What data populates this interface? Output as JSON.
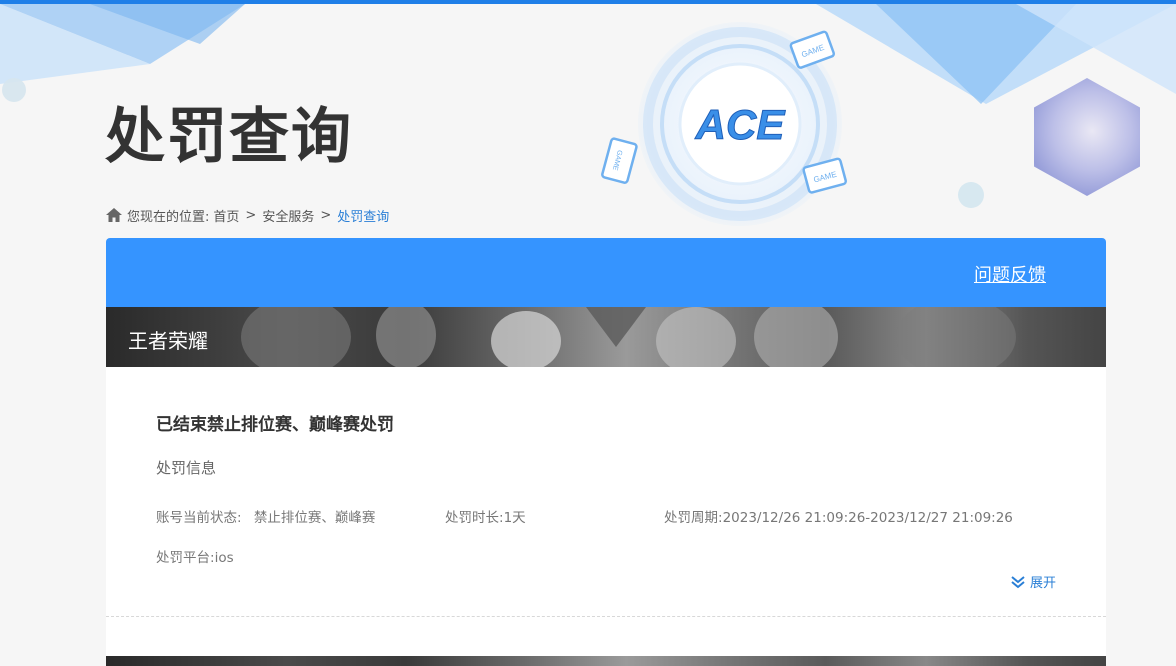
{
  "page": {
    "title": "处罚查询"
  },
  "emblem": {
    "logo_text": "ACE",
    "game_tags": [
      "GAME",
      "GAME",
      "GAME"
    ]
  },
  "breadcrumb": {
    "prefix": "您现在的位置:",
    "items": [
      "首页",
      "安全服务",
      "处罚查询"
    ],
    "separator": ">",
    "icon": "home-icon"
  },
  "card": {
    "feedback_label": "问题反馈",
    "game_name": "王者荣耀",
    "penalty": {
      "title": "已结束禁止排位赛、巅峰赛处罚",
      "info_heading": "处罚信息",
      "status_label": "账号当前状态:",
      "status_value": "禁止排位赛、巅峰赛",
      "duration_label": "处罚时长:",
      "duration_value": "1天",
      "period_label": "处罚周期:",
      "period_value": "2023/12/26 21:09:26-2023/12/27 21:09:26",
      "platform_label": "处罚平台:",
      "platform_value": "ios",
      "expand_label": "展开"
    }
  },
  "colors": {
    "accent_blue": "#3594ff",
    "link_blue": "#2a7fd6",
    "top_line": "#1f7fe8"
  }
}
